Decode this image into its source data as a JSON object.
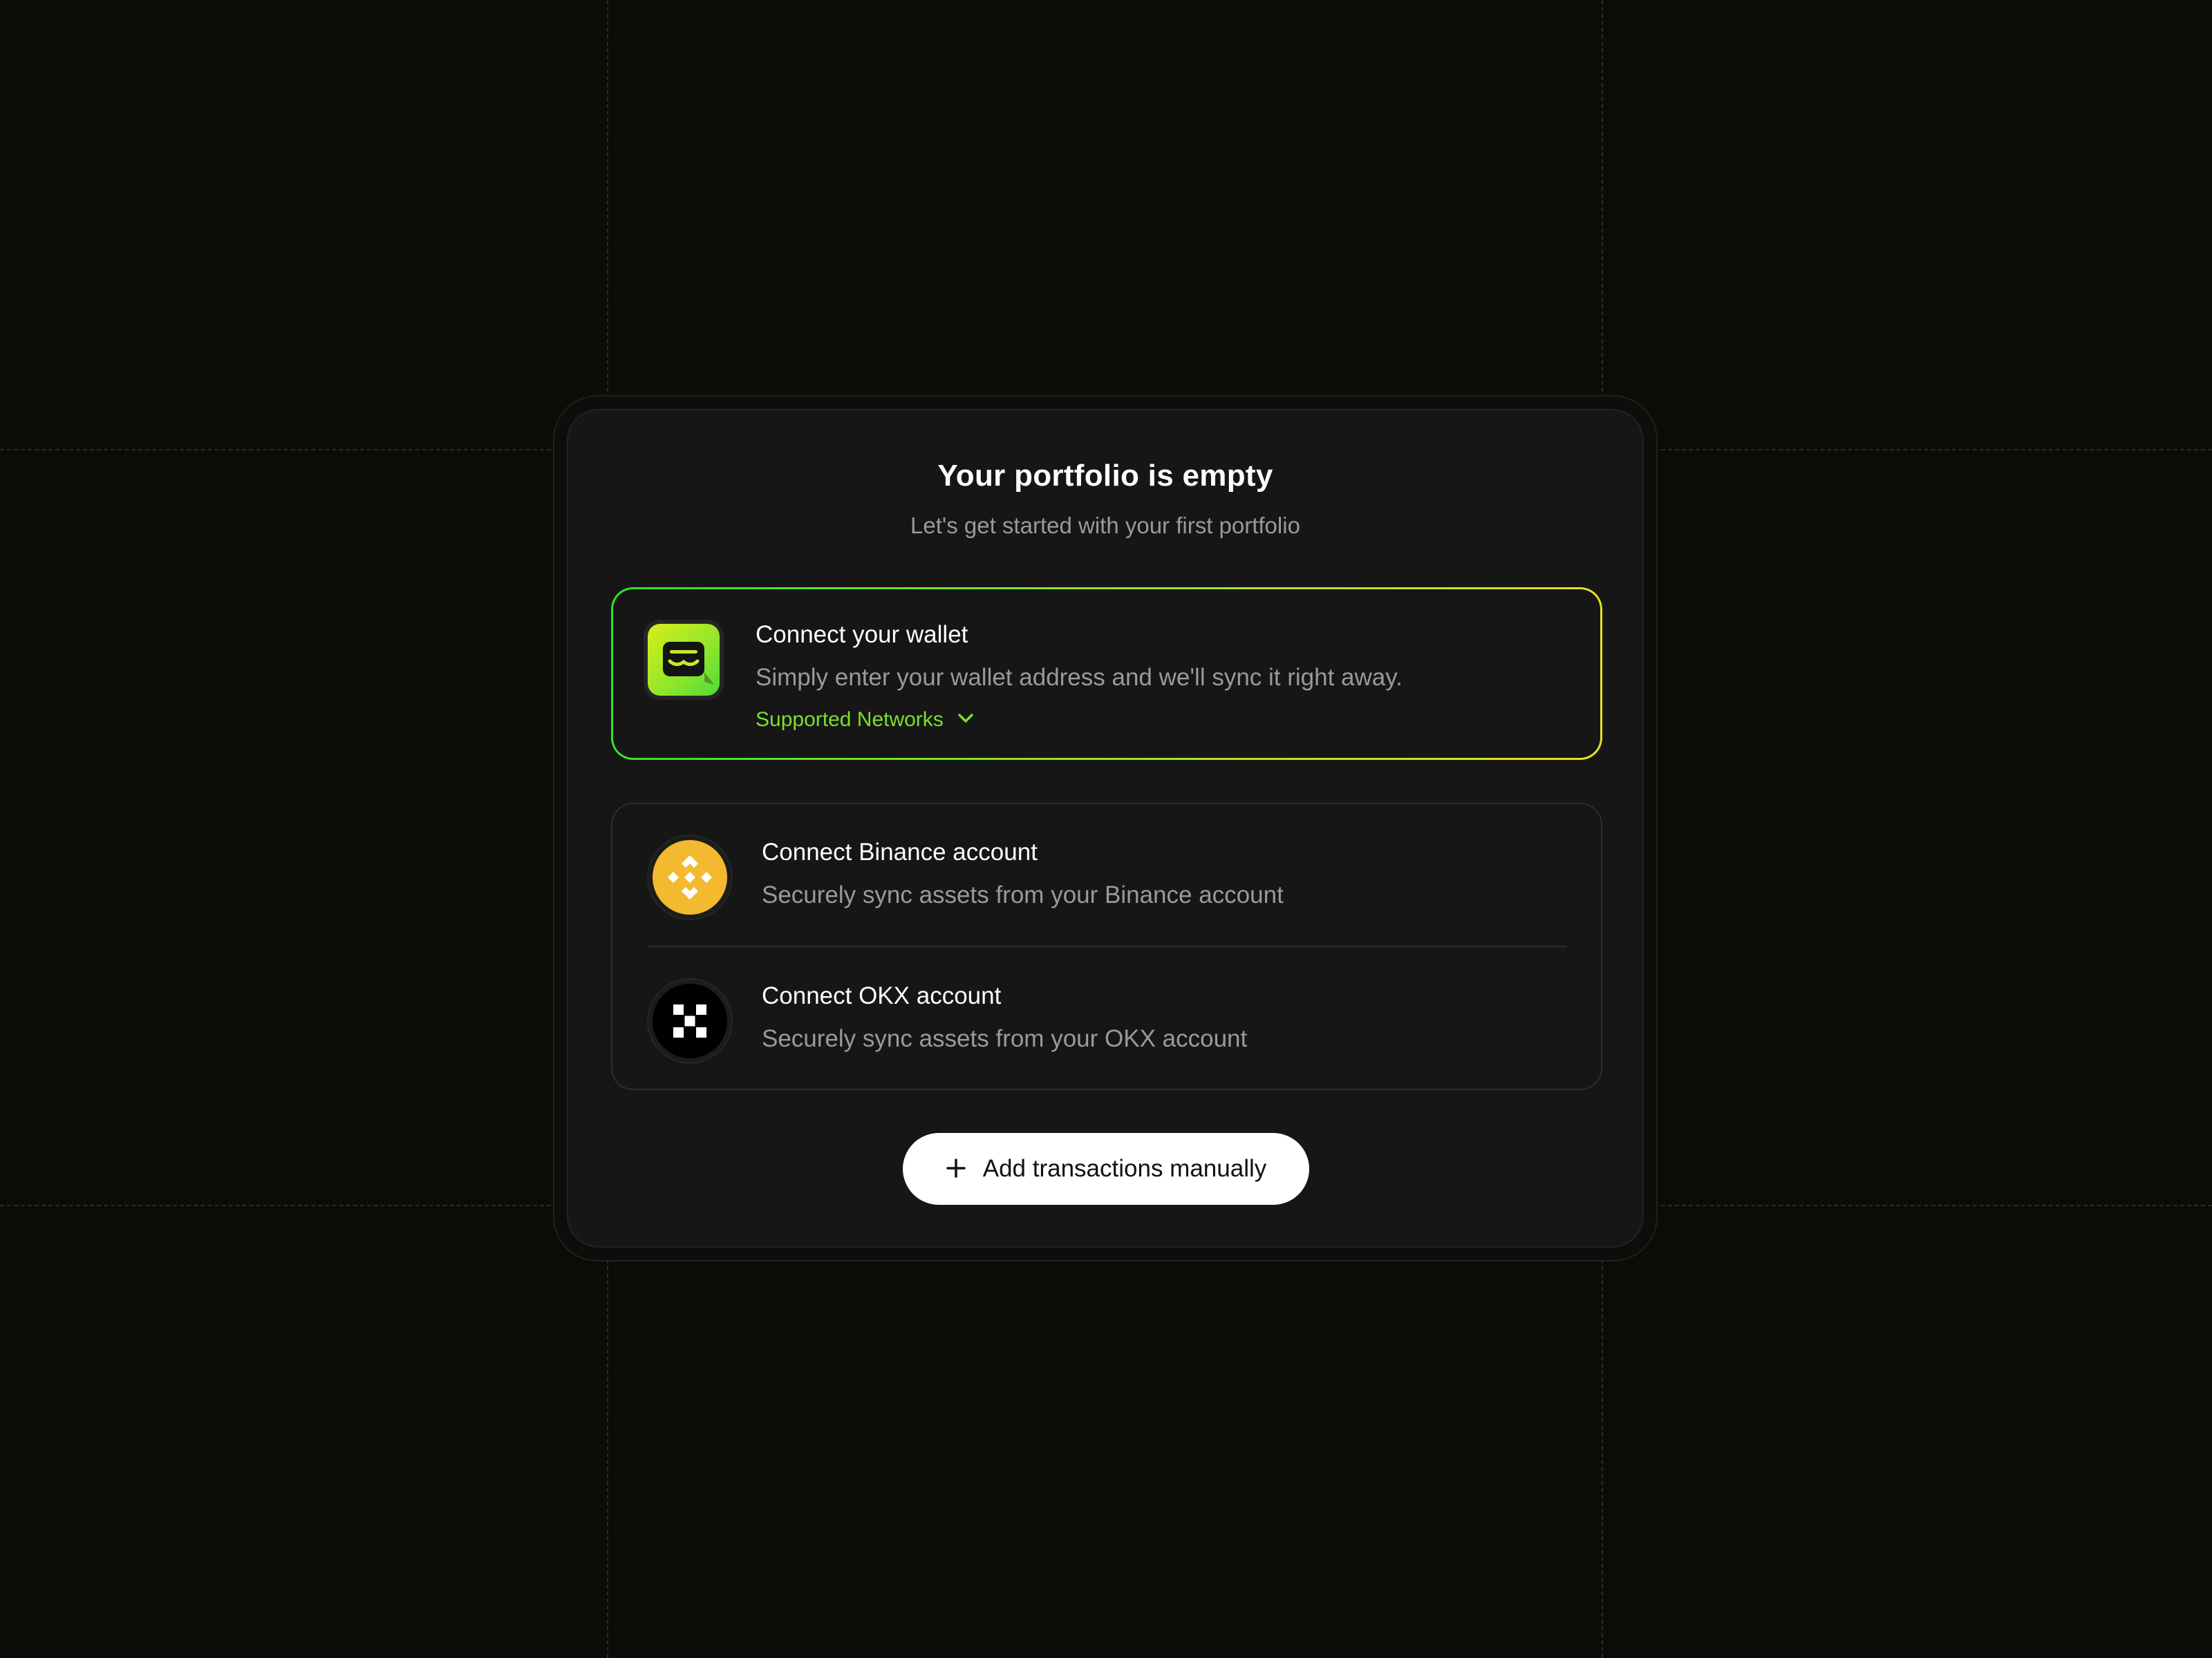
{
  "page": {
    "title": "Your portfolio is empty",
    "subtitle": "Let's get started with your first portfolio"
  },
  "wallet_option": {
    "icon": "wallet-icon",
    "title": "Connect your wallet",
    "description": "Simply enter your wallet address and we'll sync it right away.",
    "networks_label": "Supported Networks",
    "networks_icon": "chevron-down-icon",
    "accent_color": "#7ce028",
    "border_gradient": [
      "#2fe02a",
      "#e8e21c"
    ]
  },
  "exchanges": [
    {
      "icon": "binance-logo-icon",
      "title": "Connect Binance account",
      "description": "Securely sync assets from your Binance account",
      "brand_color": "#f3ba2f"
    },
    {
      "icon": "okx-logo-icon",
      "title": "Connect OKX account",
      "description": "Securely sync assets from your OKX account",
      "brand_color": "#000000"
    }
  ],
  "manual_button": {
    "icon": "plus-icon",
    "label": "Add transactions manually"
  },
  "colors": {
    "background": "#0a0c08",
    "card": "#161616",
    "text_primary": "#ffffff",
    "text_secondary": "#9a9a9a"
  }
}
